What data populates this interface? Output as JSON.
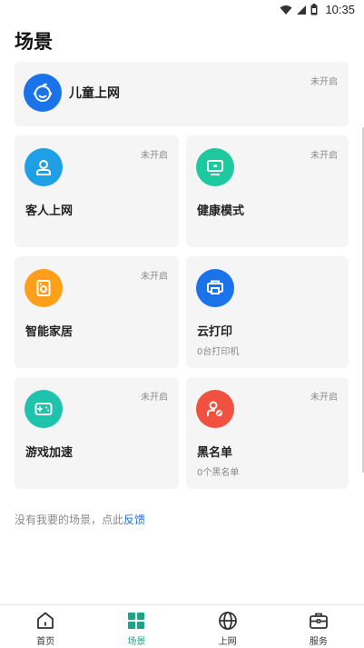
{
  "status_bar": {
    "time": "10:35"
  },
  "page_title": "场景",
  "kids": {
    "label": "儿童上网",
    "state": "未开启",
    "color": "#1a73e8"
  },
  "scenes": [
    {
      "label": "客人上网",
      "state": "未开启",
      "sub": "",
      "color": "#1e9fe6",
      "icon": "guest-user-icon"
    },
    {
      "label": "健康模式",
      "state": "未开启",
      "sub": "",
      "color": "#1fc9a0",
      "icon": "monitor-icon"
    },
    {
      "label": "智能家居",
      "state": "未开启",
      "sub": "",
      "color": "#ff9f1a",
      "icon": "smart-home-icon"
    },
    {
      "label": "云打印",
      "state": "",
      "sub": "0台打印机",
      "color": "#1a73e8",
      "icon": "printer-icon"
    },
    {
      "label": "游戏加速",
      "state": "未开启",
      "sub": "",
      "color": "#1fc3ad",
      "icon": "gamepad-icon"
    },
    {
      "label": "黑名单",
      "state": "未开启",
      "sub": "0个黑名单",
      "color": "#f0523f",
      "icon": "blocked-user-icon"
    }
  ],
  "feedback": {
    "text": "没有我要的场景，点此",
    "link": "反馈"
  },
  "nav": {
    "items": [
      {
        "label": "首页",
        "icon": "home-icon"
      },
      {
        "label": "场景",
        "icon": "grid-icon"
      },
      {
        "label": "上网",
        "icon": "globe-icon"
      },
      {
        "label": "服务",
        "icon": "briefcase-icon"
      }
    ],
    "active_color": "#1aa488"
  }
}
